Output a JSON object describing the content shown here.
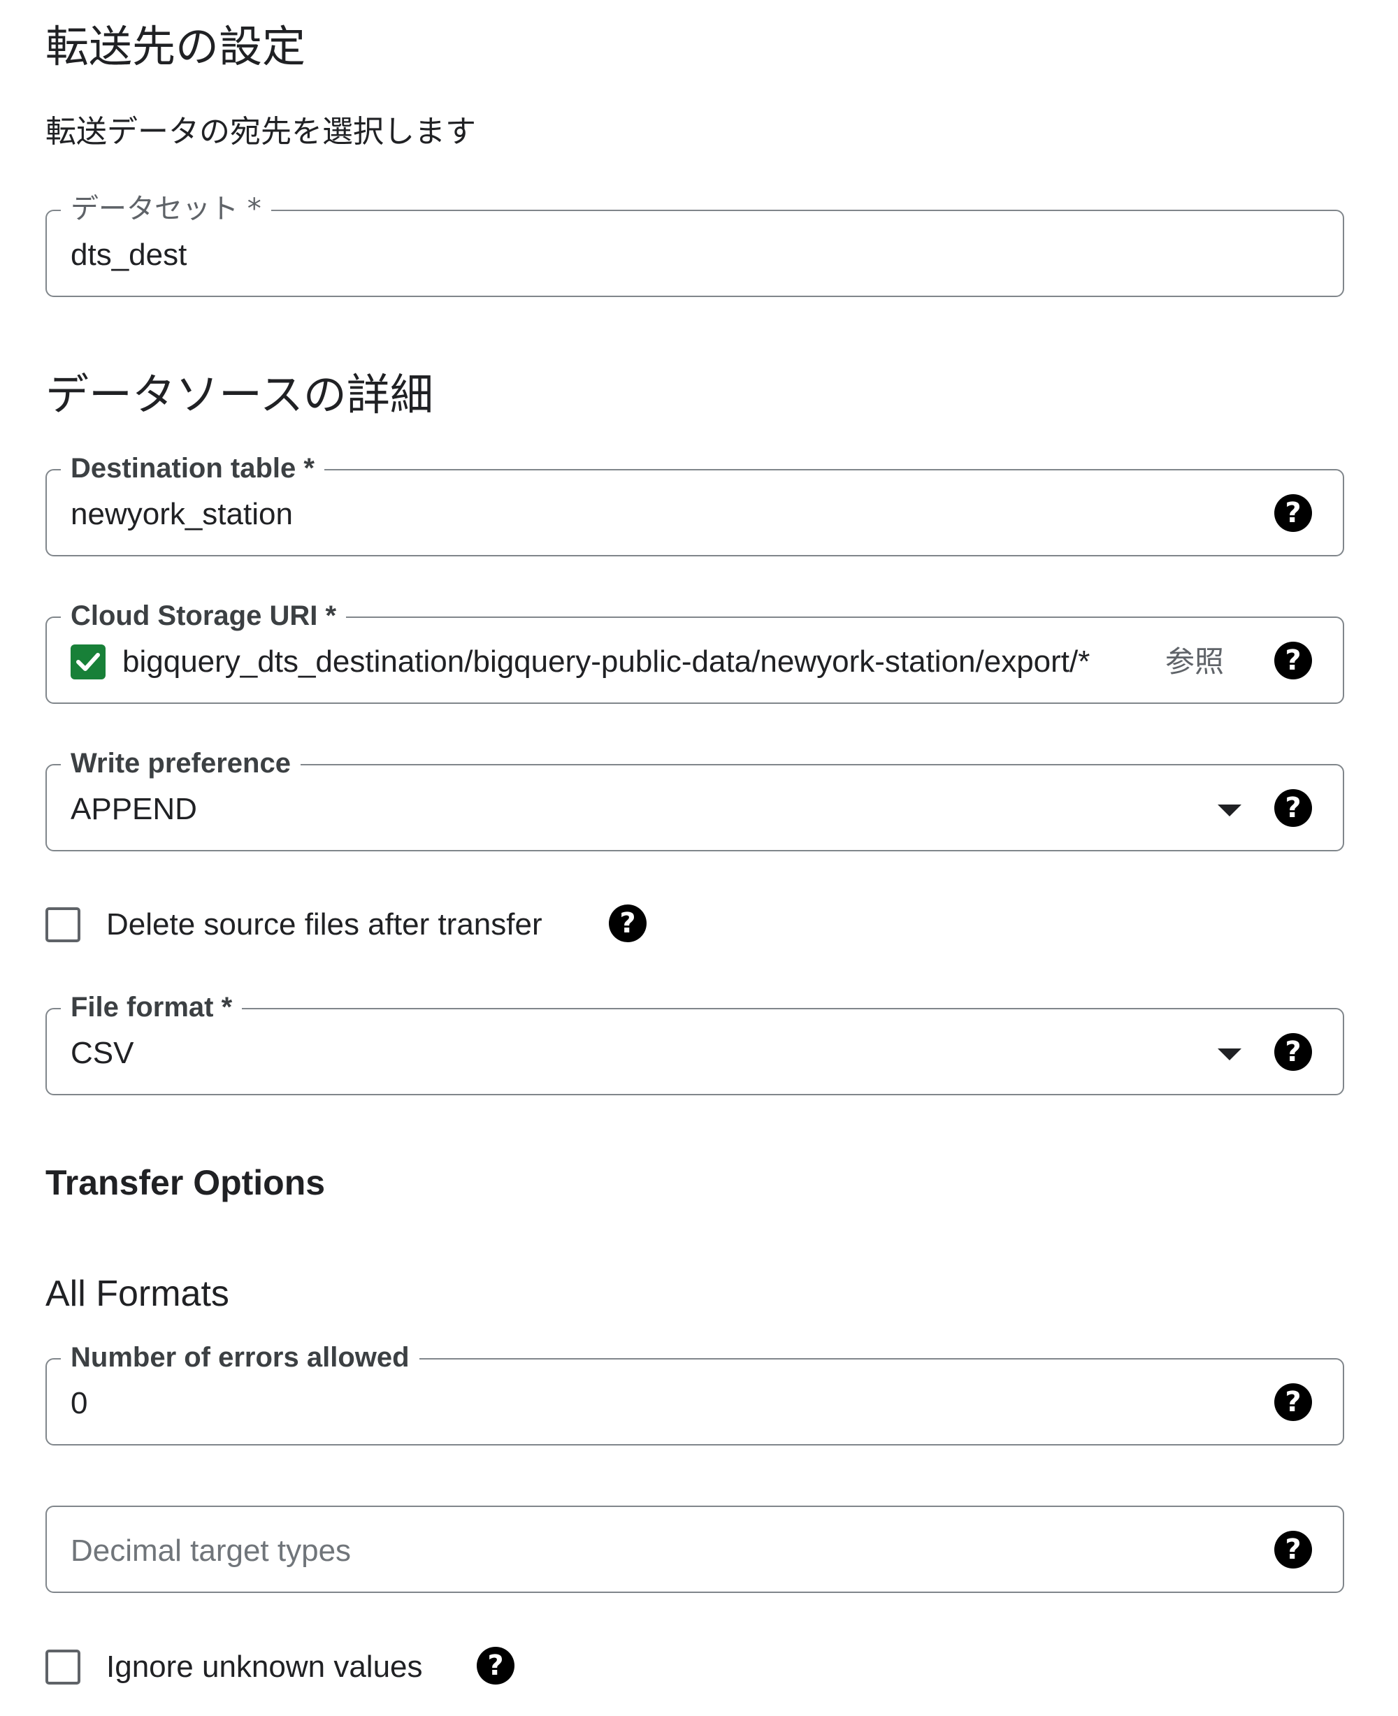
{
  "destination": {
    "title": "転送先の設定",
    "subtitle": "転送データの宛先を選択します",
    "dataset_label": "データセット *",
    "dataset_value": "dts_dest"
  },
  "source": {
    "title": "データソースの詳細",
    "destination_table_label": "Destination table *",
    "destination_table_value": "newyork_station",
    "uri_label": "Cloud Storage URI *",
    "uri_value": "bigquery_dts_destination/bigquery-public-data/newyork-station/export/*",
    "uri_browse": "参照",
    "write_pref_label": "Write preference",
    "write_pref_value": "APPEND",
    "delete_source_label": "Delete source files after transfer",
    "file_format_label": "File format *",
    "file_format_value": "CSV"
  },
  "transfer_options": {
    "title": "Transfer Options",
    "all_formats_title": "All Formats",
    "errors_label": "Number of errors allowed",
    "errors_value": "0",
    "decimal_placeholder": "Decimal target types",
    "ignore_unknown_label": "Ignore unknown values"
  },
  "icons": {
    "help": "?",
    "help_icon_name": "help-circle-icon",
    "dropdown_icon_name": "caret-down-icon",
    "check_icon_name": "check-icon"
  },
  "colors": {
    "check_green": "#188038",
    "border": "#80868b",
    "text": "#202124"
  }
}
